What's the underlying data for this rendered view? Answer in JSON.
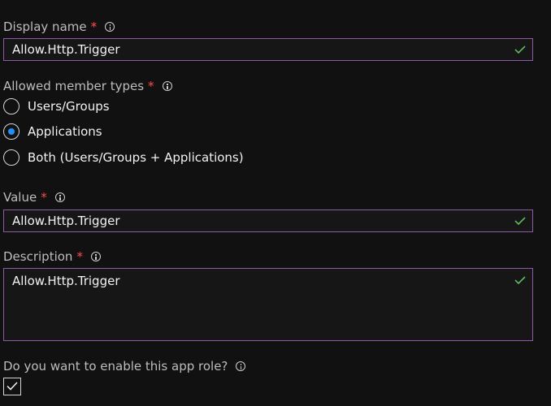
{
  "display_name": {
    "label": "Display name",
    "required": "*",
    "value": "Allow.Http.Trigger"
  },
  "member_types": {
    "label": "Allowed member types",
    "required": "*",
    "options": [
      {
        "label": "Users/Groups",
        "selected": false
      },
      {
        "label": "Applications",
        "selected": true
      },
      {
        "label": "Both (Users/Groups + Applications)",
        "selected": false
      }
    ]
  },
  "value_field": {
    "label": "Value",
    "required": "*",
    "value": "Allow.Http.Trigger"
  },
  "description": {
    "label": "Description",
    "required": "*",
    "value": "Allow.Http.Trigger"
  },
  "enable_role": {
    "label": "Do you want to enable this app role?",
    "checked": true
  },
  "colors": {
    "background": "#111111",
    "field_border": "#8b5aa8",
    "required_asterisk": "#ff4d4d",
    "valid_check": "#5fb85f",
    "radio_selected": "#1e90ff"
  },
  "icons": {
    "info": "info-icon",
    "valid": "checkmark-icon"
  }
}
